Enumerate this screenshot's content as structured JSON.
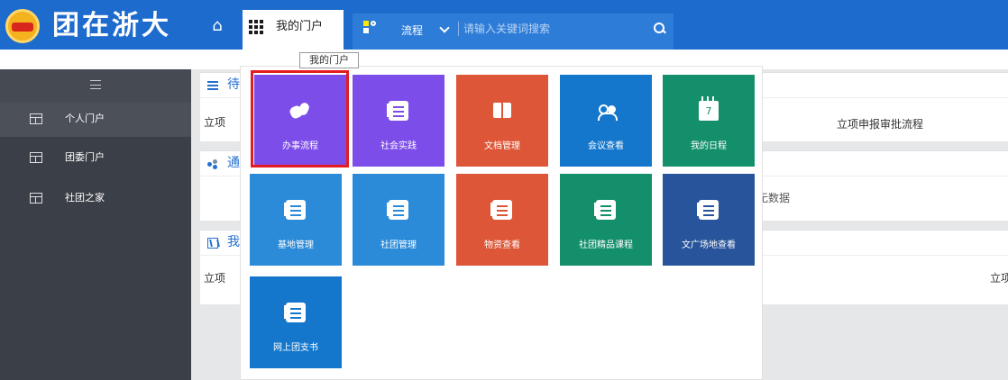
{
  "brand": {
    "title": "团在浙大"
  },
  "header": {
    "portal_tab": {
      "label": "我的门户"
    },
    "tooltip": "我的门户",
    "flow": {
      "label": "流程"
    },
    "search": {
      "placeholder": "请输入关键词搜索",
      "icon": "search-icon"
    }
  },
  "sidebar": {
    "items": [
      {
        "label": "个人门户",
        "active": true
      },
      {
        "label": "团委门户"
      },
      {
        "label": "社团之家"
      }
    ]
  },
  "main": {
    "panels": [
      {
        "heading_fragment": "待",
        "row_label": "立项",
        "cell": "立项申报审批流程"
      },
      {
        "heading_fragment": "通",
        "empty_text": "无数据"
      },
      {
        "heading_fragment": "我",
        "row_label": "立项",
        "right_fragment": "立项"
      }
    ]
  },
  "portal_menu": {
    "selected_index": 0,
    "tiles": [
      {
        "label": "办事流程",
        "icon": "hand-icon",
        "color": "#7c4de8"
      },
      {
        "label": "社会实践",
        "icon": "document-icon",
        "color": "#7c4de8"
      },
      {
        "label": "文档管理",
        "icon": "book-icon",
        "color": "#dd5637"
      },
      {
        "label": "会议查看",
        "icon": "people-icon",
        "color": "#1477cc"
      },
      {
        "label": "我的日程",
        "icon": "calendar-icon",
        "color": "#148f6c",
        "day": "7"
      },
      {
        "label": "基地管理",
        "icon": "document-icon",
        "color": "#2b8bd8"
      },
      {
        "label": "社团管理",
        "icon": "document-icon",
        "color": "#2b8bd8"
      },
      {
        "label": "物资查看",
        "icon": "document-icon",
        "color": "#dd5637"
      },
      {
        "label": "社团精品课程",
        "icon": "document-icon",
        "color": "#148f6c"
      },
      {
        "label": "文广场地查看",
        "icon": "document-icon",
        "color": "#27549b"
      },
      {
        "label": "网上团支书",
        "icon": "document-icon",
        "color": "#1477cc"
      }
    ]
  },
  "colors": {
    "topbar": "#1d6bcd",
    "search_bar": "#2d7cd7",
    "sidebar": "#3b3f47",
    "highlight": "#e51c1f"
  }
}
